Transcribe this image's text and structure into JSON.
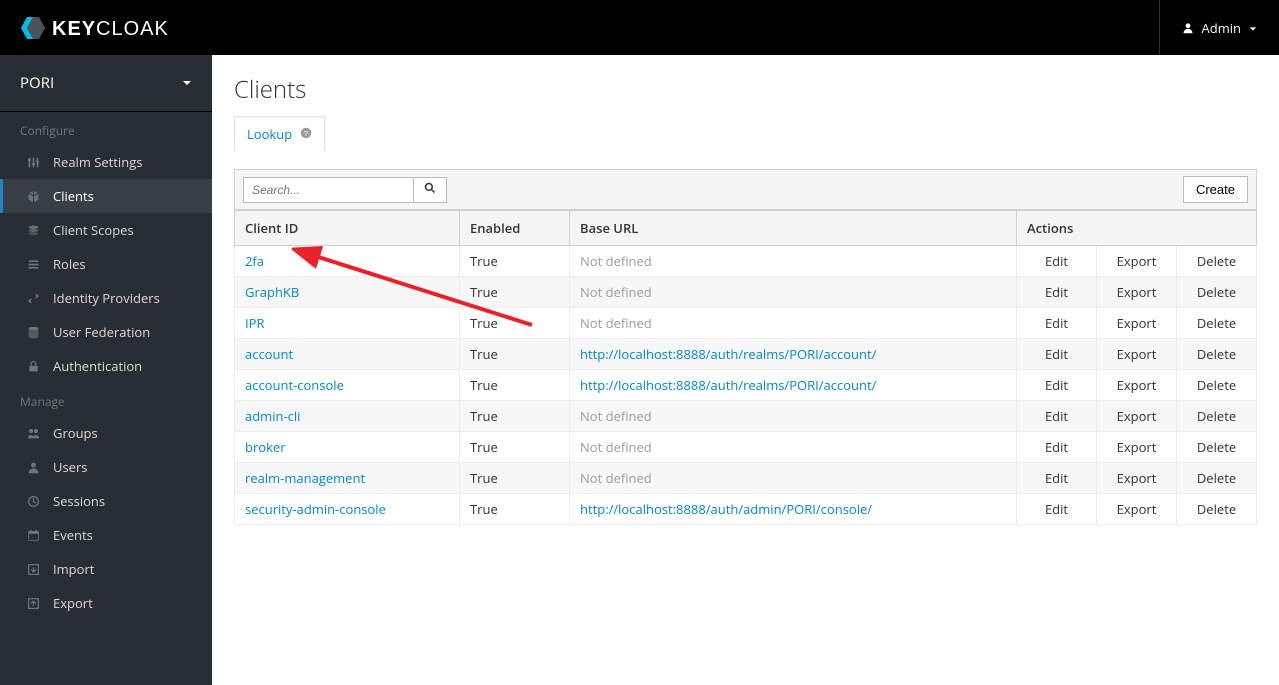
{
  "brand": "KEYCLOAK",
  "admin_label": "Admin",
  "realm_name": "PORI",
  "sidebar": {
    "configure_label": "Configure",
    "manage_label": "Manage",
    "items": {
      "realm_settings": "Realm Settings",
      "clients": "Clients",
      "client_scopes": "Client Scopes",
      "roles": "Roles",
      "identity_providers": "Identity Providers",
      "user_federation": "User Federation",
      "authentication": "Authentication",
      "groups": "Groups",
      "users": "Users",
      "sessions": "Sessions",
      "events": "Events",
      "import": "Import",
      "export": "Export"
    }
  },
  "page": {
    "title": "Clients",
    "tab_lookup": "Lookup",
    "search_placeholder": "Search...",
    "create_label": "Create",
    "col_client_id": "Client ID",
    "col_enabled": "Enabled",
    "col_base_url": "Base URL",
    "col_actions": "Actions",
    "action_edit": "Edit",
    "action_export": "Export",
    "action_delete": "Delete",
    "not_defined": "Not defined"
  },
  "clients": [
    {
      "id": "2fa",
      "enabled": "True",
      "base_url": ""
    },
    {
      "id": "GraphKB",
      "enabled": "True",
      "base_url": ""
    },
    {
      "id": "IPR",
      "enabled": "True",
      "base_url": ""
    },
    {
      "id": "account",
      "enabled": "True",
      "base_url": "http://localhost:8888/auth/realms/PORI/account/"
    },
    {
      "id": "account-console",
      "enabled": "True",
      "base_url": "http://localhost:8888/auth/realms/PORI/account/"
    },
    {
      "id": "admin-cli",
      "enabled": "True",
      "base_url": ""
    },
    {
      "id": "broker",
      "enabled": "True",
      "base_url": ""
    },
    {
      "id": "realm-management",
      "enabled": "True",
      "base_url": ""
    },
    {
      "id": "security-admin-console",
      "enabled": "True",
      "base_url": "http://localhost:8888/auth/admin/PORI/console/"
    }
  ]
}
